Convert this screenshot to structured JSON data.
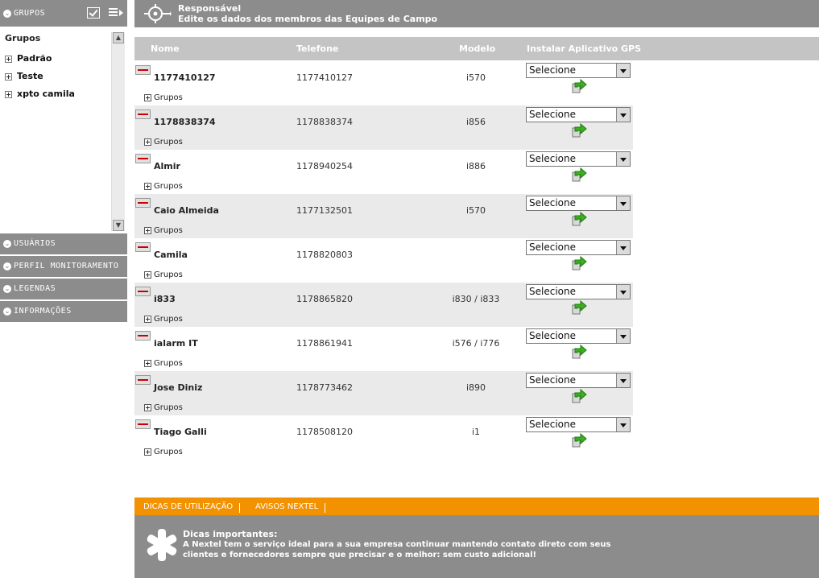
{
  "sidebar": {
    "groups_header": "GRUPOS",
    "tree_title": "Grupos",
    "tree_items": [
      "Padrão",
      "Teste",
      "xpto camila"
    ],
    "sections": [
      "USUÁRIOS",
      "PERFIL MONITORAMENTO",
      "LEGENDAS",
      "INFORMAÇÕES"
    ]
  },
  "header": {
    "title": "Responsável",
    "subtitle": "Edite os dados dos membros das Equipes de Campo"
  },
  "table": {
    "columns": [
      "Nome",
      "Telefone",
      "Modelo",
      "Instalar Aplicativo GPS"
    ],
    "groups_label": "Grupos",
    "select_value": "Selecione",
    "rows": [
      {
        "name": "1177410127",
        "phone": "1177410127",
        "model": "i570"
      },
      {
        "name": "1178838374",
        "phone": "1178838374",
        "model": "i856"
      },
      {
        "name": "Almir",
        "phone": "1178940254",
        "model": "i886"
      },
      {
        "name": "Caio Almeida",
        "phone": "1177132501",
        "model": "i570"
      },
      {
        "name": "Camila",
        "phone": "1178820803",
        "model": ""
      },
      {
        "name": "i833",
        "phone": "1178865820",
        "model": "i830 / i833"
      },
      {
        "name": "ialarm IT",
        "phone": "1178861941",
        "model": "i576 / i776"
      },
      {
        "name": "Jose Diniz",
        "phone": "1178773462",
        "model": "i890"
      },
      {
        "name": "Tiago Galli",
        "phone": "1178508120",
        "model": "i1"
      }
    ]
  },
  "footer": {
    "tab1": "DICAS DE UTILIZAÇÃO",
    "tab2": "AVISOS NEXTEL",
    "tips_title": "Dicas importantes:",
    "tips_text": "A Nextel tem o serviço ideal para a sua empresa continuar mantendo contato direto com seus clientes e fornecedores sempre que precisar e o melhor: sem custo adicional!"
  },
  "colors": {
    "header_gray": "#8c8c8c",
    "column_header": "#c4c4c4",
    "row_alt": "#eaeaea",
    "orange": "#f39200",
    "install_green": "#3cb020"
  }
}
